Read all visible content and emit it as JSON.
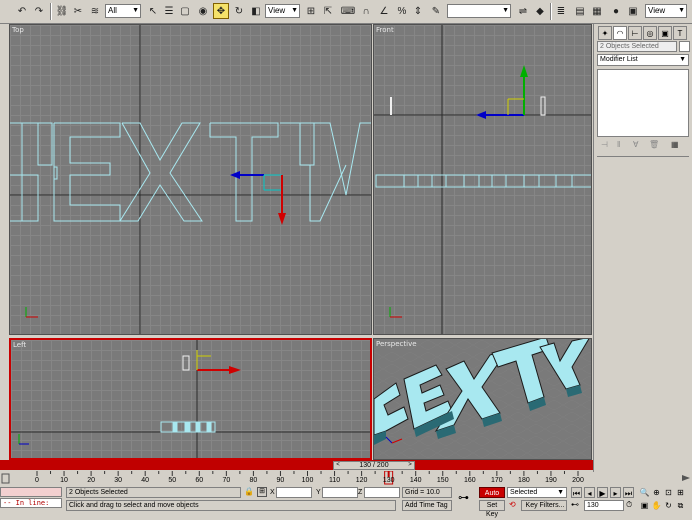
{
  "toolbar": {
    "selection_filter": "All",
    "ref_coord": "View",
    "named_selection": "",
    "view_dropdown": "View"
  },
  "viewports": {
    "top": {
      "label": "Top"
    },
    "front": {
      "label": "Front"
    },
    "left": {
      "label": "Left"
    },
    "perspective": {
      "label": "Perspective"
    }
  },
  "command_panel": {
    "object_name": "2 Objects Selected",
    "modifier_list": "Modifier List"
  },
  "time_slider": {
    "label": "130 / 200",
    "left_arrow": "<",
    "right_arrow": ">"
  },
  "timeline": {
    "ticks": [
      "0",
      "10",
      "20",
      "30",
      "40",
      "50",
      "60",
      "70",
      "80",
      "90",
      "100",
      "110",
      "120",
      "130",
      "140",
      "150",
      "160",
      "170",
      "180",
      "190",
      "200"
    ],
    "current_frame": 130,
    "start": 0,
    "end": 200
  },
  "status": {
    "maxscript_prompt": "-- In line:",
    "selection_text": "2 Objects Selected",
    "prompt_text": "Click and drag to select and move objects",
    "x_label": "X",
    "y_label": "Y",
    "z_label": "Z",
    "x_value": "",
    "y_value": "",
    "z_value": "",
    "grid": "Grid = 10.0",
    "add_time_tag": "Add Time Tag",
    "auto_key": "Auto Key",
    "set_key": "Set Key",
    "key_mode": "Selected",
    "key_filters": "Key Filters...",
    "frame_value": "130"
  },
  "colors": {
    "active_viewport": "#c80000",
    "wireframe": "#a8e8f0",
    "gizmo_x": "#d00000",
    "gizmo_y": "#00b000",
    "gizmo_z": "#0000c8"
  }
}
